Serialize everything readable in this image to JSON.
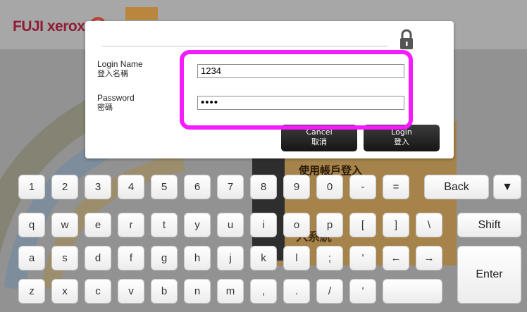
{
  "background": {
    "brand": "FUJI xerox",
    "panel_heading": "使用帳戶登入",
    "panel_subtext": "入系統"
  },
  "dialog": {
    "login_name_label": "Login Name",
    "login_name_label_zh": "登入名稱",
    "password_label": "Password",
    "password_label_zh": "密碼",
    "login_name_value": "1234",
    "password_value": "••••",
    "cancel_label": "Cancel",
    "cancel_label_zh": "取消",
    "login_label": "Login",
    "login_label_zh": "登入"
  },
  "keyboard": {
    "row1": [
      "1",
      "2",
      "3",
      "4",
      "5",
      "6",
      "7",
      "8",
      "9",
      "0",
      "-",
      "="
    ],
    "row2": [
      "q",
      "w",
      "e",
      "r",
      "t",
      "y",
      "u",
      "i",
      "o",
      "p",
      "[",
      "]",
      "\\"
    ],
    "row3": [
      "a",
      "s",
      "d",
      "f",
      "g",
      "h",
      "j",
      "k",
      "l",
      ";",
      "'",
      "←",
      "→"
    ],
    "row4": [
      "z",
      "x",
      "c",
      "v",
      "b",
      "n",
      "m",
      ",",
      ".",
      "/",
      "'",
      ""
    ],
    "back": "Back",
    "dropdown": "▼",
    "shift": "Shift",
    "enter": "Enter"
  },
  "colors": {
    "highlight": "#f21cff",
    "brand": "#8e1e35",
    "panel": "#a5834a"
  }
}
